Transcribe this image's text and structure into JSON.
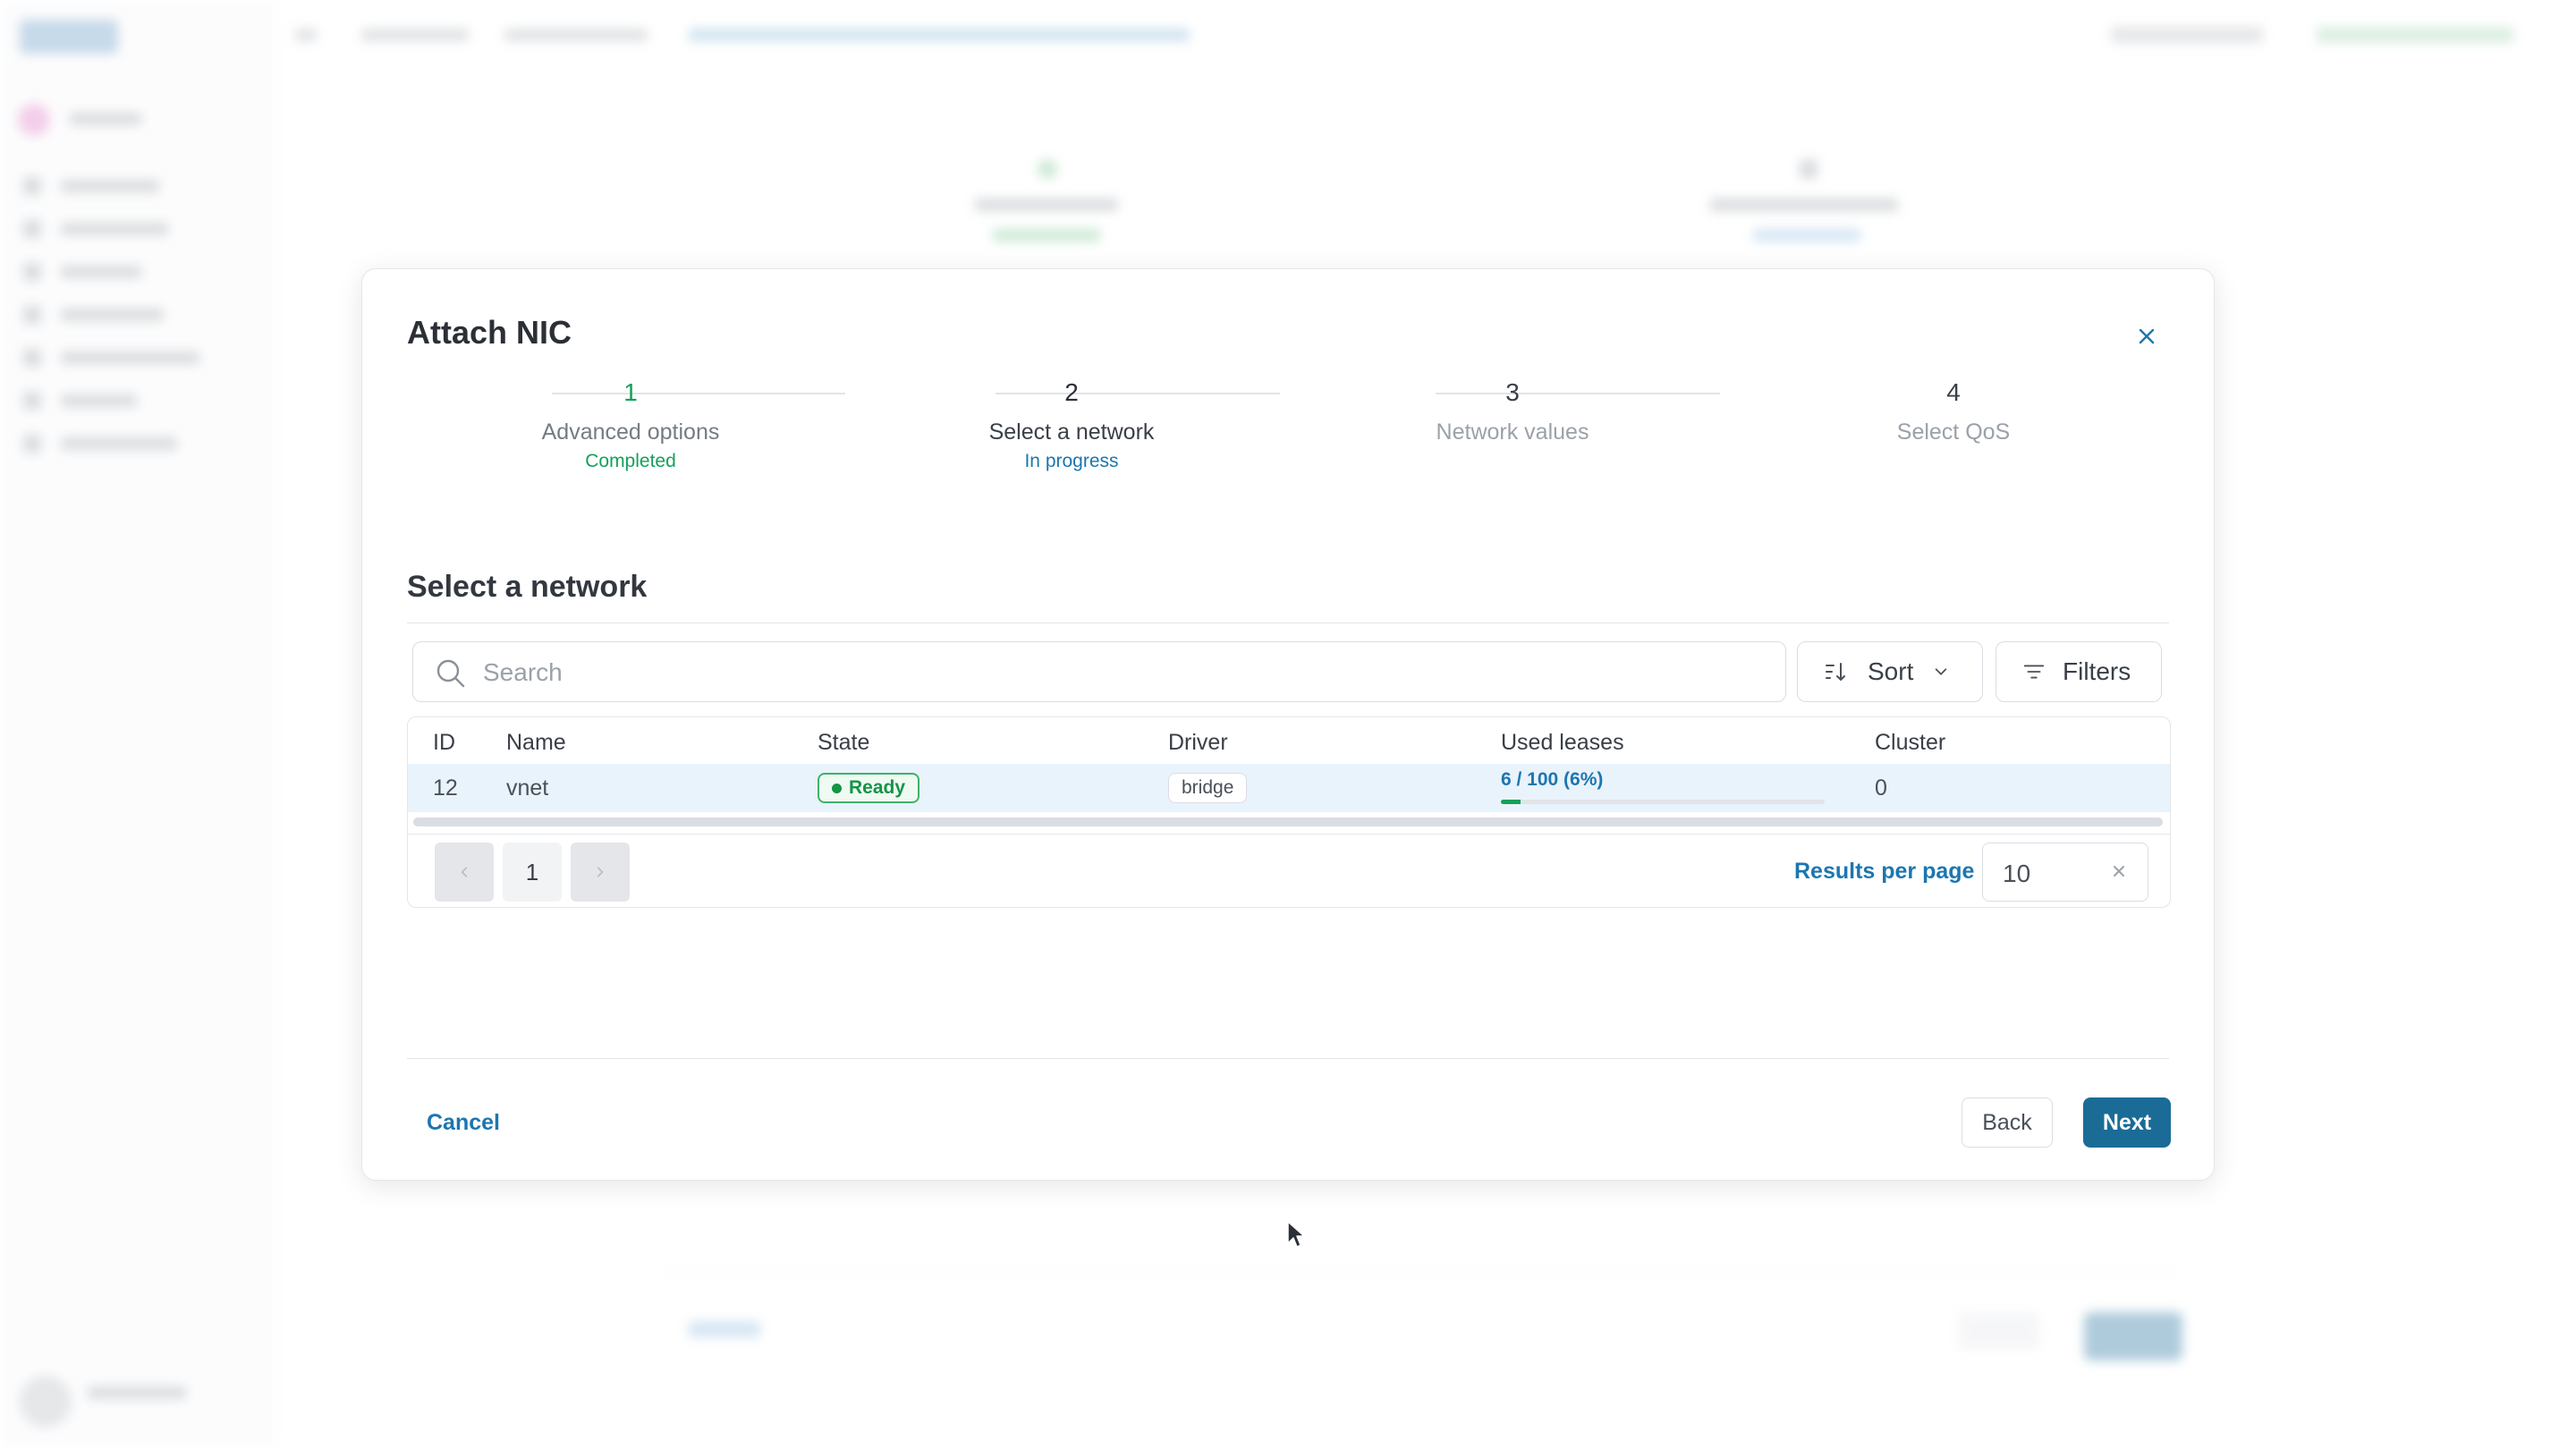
{
  "dialog": {
    "title": "Attach NIC",
    "close_icon": "close-icon"
  },
  "stepper": {
    "steps": [
      {
        "number": "1",
        "label": "Advanced options",
        "status": "Completed",
        "state": "done"
      },
      {
        "number": "2",
        "label": "Select a network",
        "status": "In progress",
        "state": "active"
      },
      {
        "number": "3",
        "label": "Network values",
        "status": "",
        "state": "todo"
      },
      {
        "number": "4",
        "label": "Select QoS",
        "status": "",
        "state": "todo"
      }
    ]
  },
  "section": {
    "title": "Select a network"
  },
  "search": {
    "placeholder": "Search",
    "value": "",
    "icon": "search-icon"
  },
  "toolbar": {
    "sort_label": "Sort",
    "sort_icon": "sort-icon",
    "filters_label": "Filters",
    "filters_icon": "filter-icon"
  },
  "table": {
    "columns": [
      "ID",
      "Name",
      "State",
      "Driver",
      "Used leases",
      "Cluster"
    ],
    "rows": [
      {
        "id": "12",
        "name": "vnet",
        "state": "Ready",
        "driver": "bridge",
        "used_leases": "6 / 100 (6%)",
        "used_leases_fraction": 0.06,
        "cluster": "0"
      }
    ]
  },
  "pagination": {
    "current_page": "1",
    "prev_icon": "chevron-left-icon",
    "next_icon": "chevron-right-icon",
    "results_per_page_label": "Results per page",
    "results_per_page_value": "10"
  },
  "footer": {
    "cancel_label": "Cancel",
    "back_label": "Back",
    "next_label": "Next"
  },
  "colors": {
    "accent": "#1c76b0",
    "primary_button": "#1a6c96",
    "success": "#14a05a",
    "selected_row": "#e9f3fb"
  }
}
